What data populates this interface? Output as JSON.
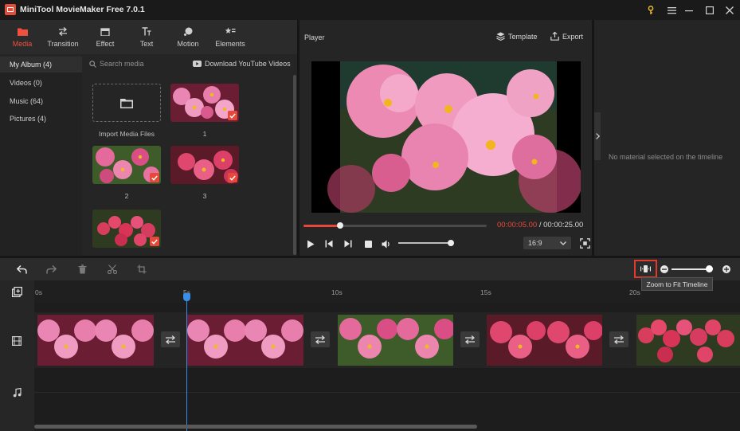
{
  "app": {
    "title": "MiniTool MovieMaker Free 7.0.1"
  },
  "tabs": [
    {
      "label": "Media",
      "icon": "folder-icon",
      "active": true
    },
    {
      "label": "Transition",
      "icon": "transition-icon",
      "active": false
    },
    {
      "label": "Effect",
      "icon": "effect-icon",
      "active": false
    },
    {
      "label": "Text",
      "icon": "text-icon",
      "active": false
    },
    {
      "label": "Motion",
      "icon": "motion-icon",
      "active": false
    },
    {
      "label": "Elements",
      "icon": "elements-icon",
      "active": false
    }
  ],
  "sidebar": {
    "items": [
      {
        "label": "My Album (4)",
        "active": true
      },
      {
        "label": "Videos (0)",
        "active": false
      },
      {
        "label": "Music (64)",
        "active": false
      },
      {
        "label": "Pictures (4)",
        "active": false
      }
    ]
  },
  "media": {
    "search_placeholder": "Search media",
    "download_label": "Download YouTube Videos",
    "import_label": "Import Media Files",
    "items": [
      {
        "caption": "1"
      },
      {
        "caption": "2"
      },
      {
        "caption": "3"
      },
      {
        "caption": ""
      }
    ]
  },
  "player": {
    "title": "Player",
    "template_label": "Template",
    "export_label": "Export",
    "current_time": "00:00:05.00",
    "separator": " / ",
    "total_time": "00:00:25.00",
    "progress": 0.2,
    "volume": 1.0,
    "aspect_ratio": "16:9"
  },
  "properties": {
    "empty_message": "No material selected on the timeline"
  },
  "timeline": {
    "tooltip": "Zoom to Fit Timeline",
    "ruler": [
      "0s",
      "5s",
      "10s",
      "15s",
      "20s"
    ],
    "playhead_time": "5s",
    "zoom_level": 1.0
  },
  "colors": {
    "accent": "#e8483a",
    "playhead": "#3a8ee6",
    "highlight_box": "#e03a2d"
  }
}
